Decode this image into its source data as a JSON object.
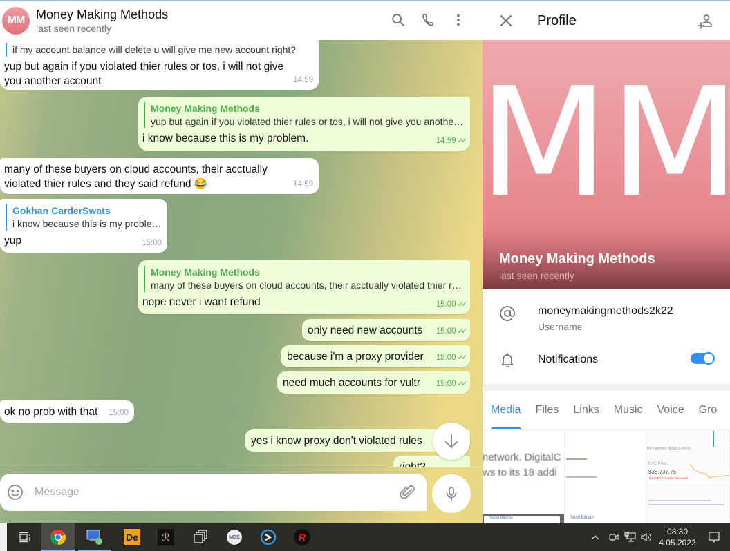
{
  "chat": {
    "header": {
      "avatar_initials": "MM",
      "title": "Money Making Methods",
      "status": "last seen recently"
    },
    "messages": [
      {
        "dir": "in",
        "reply": {
          "name": "",
          "text": "if my account balance will delete u will give me new account right?"
        },
        "text": "yup but again if you violated thier rules or tos, i will not give you another account",
        "time": "14:59"
      },
      {
        "dir": "out",
        "reply": {
          "name": "Money Making Methods",
          "text": "yup but again if you violated thier rules or tos, i will not give you another…"
        },
        "text": "i know because this is my problem.",
        "time": "14:59",
        "read": true
      },
      {
        "dir": "in",
        "text": "many of these buyers on cloud accounts, their acctually violated thier rules and they said refund 😂",
        "time": "14:59"
      },
      {
        "dir": "in",
        "reply": {
          "name": "Gokhan CarderSwats",
          "text": "i know because this is my problem."
        },
        "text": "yup",
        "time": "15:00"
      },
      {
        "dir": "out",
        "reply": {
          "name": "Money Making Methods",
          "text": "many of these buyers on cloud accounts, their acctually violated thier r…"
        },
        "text": "nope never i want refund",
        "time": "15:00",
        "read": true
      },
      {
        "dir": "out",
        "text": "only need new accounts",
        "time": "15:00",
        "read": true
      },
      {
        "dir": "out",
        "text": "because i'm a proxy provider",
        "time": "15:00",
        "read": true
      },
      {
        "dir": "out",
        "text": "need much accounts for vultr",
        "time": "15:00",
        "read": true
      },
      {
        "dir": "in",
        "text": "ok no prob with that",
        "time": "15:00"
      },
      {
        "dir": "out",
        "text": "yes i know proxy don't violated rules",
        "time": ""
      },
      {
        "dir": "out",
        "text": "right?",
        "time": ""
      }
    ],
    "composer": {
      "placeholder": "Message"
    }
  },
  "profile": {
    "title": "Profile",
    "initials": "MM",
    "name": "Money Making Methods",
    "status": "last seen recently",
    "username": "moneymakingmethods2k22",
    "username_label": "Username",
    "notifications_label": "Notifications",
    "notifications_on": true,
    "tabs": [
      "Media",
      "Files",
      "Links",
      "Music",
      "Voice",
      "Gro"
    ],
    "active_tab": "Media",
    "media": {
      "thumb1_text": [
        "network. DigitalC",
        "ws to its 18 addi"
      ],
      "thumb1_footer": "Send Bitcoin",
      "thumb2_footer": "Send Bitcoin",
      "thumb3_tagline": "the's premier digital currency",
      "thumb3_price_label": "BTC Price",
      "thumb3_price": "$38.737,75",
      "thumb3_change": "-$2.838,18 -6.83% this week"
    }
  },
  "taskbar": {
    "apps": [
      "task-view",
      "chrome",
      "remote-desktop",
      "dreamweaver",
      "app-gold",
      "window-switcher",
      "mds",
      "app-s",
      "redline"
    ],
    "time": "08:30",
    "date": "4.05.2022"
  },
  "colors": {
    "accent": "#3390ec",
    "outgoing": "#eefed9",
    "outgoing_text": "#4fae4e",
    "avatar": "#e1727a"
  }
}
